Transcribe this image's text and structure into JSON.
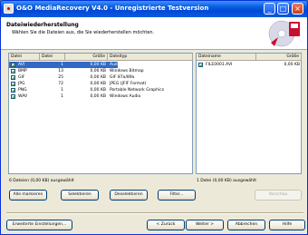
{
  "window": {
    "title": "O&O MediaRecovery V4.0 - Unregistrierte Testversion",
    "minimize": "_",
    "maximize": "□",
    "close": "×"
  },
  "header": {
    "title": "Dateiwiederherstellung",
    "subtitle": "Wählen Sie die Dateien aus, die Sie wiederherstellen möchten."
  },
  "file_table": {
    "columns": [
      "Datei",
      "Datei",
      "Größe",
      "Dateityp"
    ],
    "rows": [
      {
        "checked": true,
        "name": "AVI",
        "count": "1",
        "size": "0,00 KB",
        "type": "Audio Video Interleave File",
        "selected": true
      },
      {
        "checked": true,
        "name": "BMP",
        "count": "13",
        "size": "0,00 KB",
        "type": "Windows Bitmap",
        "selected": false
      },
      {
        "checked": true,
        "name": "GIF",
        "count": "25",
        "size": "0,00 KB",
        "type": "GIF 87a/89a",
        "selected": false
      },
      {
        "checked": true,
        "name": "JPG",
        "count": "72",
        "size": "0,00 KB",
        "type": "JPEG (JFIF Format)",
        "selected": false
      },
      {
        "checked": true,
        "name": "PNG",
        "count": "1",
        "size": "0,00 KB",
        "type": "Portable Network Graphics",
        "selected": false
      },
      {
        "checked": true,
        "name": "WAV",
        "count": "1",
        "size": "0,00 KB",
        "type": "Windows Audio",
        "selected": false
      }
    ]
  },
  "detail_table": {
    "columns": [
      "Dateiname",
      "Größe"
    ],
    "rows": [
      {
        "checked": true,
        "name": "FILE0001.AVI",
        "size": "0,00 KB"
      }
    ]
  },
  "status": {
    "left": "6 Dateien (0,00 KB) ausgewählt",
    "right": "1 Datei (0,00 KB) ausgewählt"
  },
  "buttons": {
    "select_all": "Alle markieren",
    "select": "Selektieren",
    "deselect": "Deselektieren",
    "filter": "Filter...",
    "preview": "Vorschau",
    "settings": "Erweiterte Einstellungen...",
    "back": "< Zurück",
    "next": "Weiter >",
    "cancel": "Abbrechen",
    "help": "Hilfe"
  }
}
